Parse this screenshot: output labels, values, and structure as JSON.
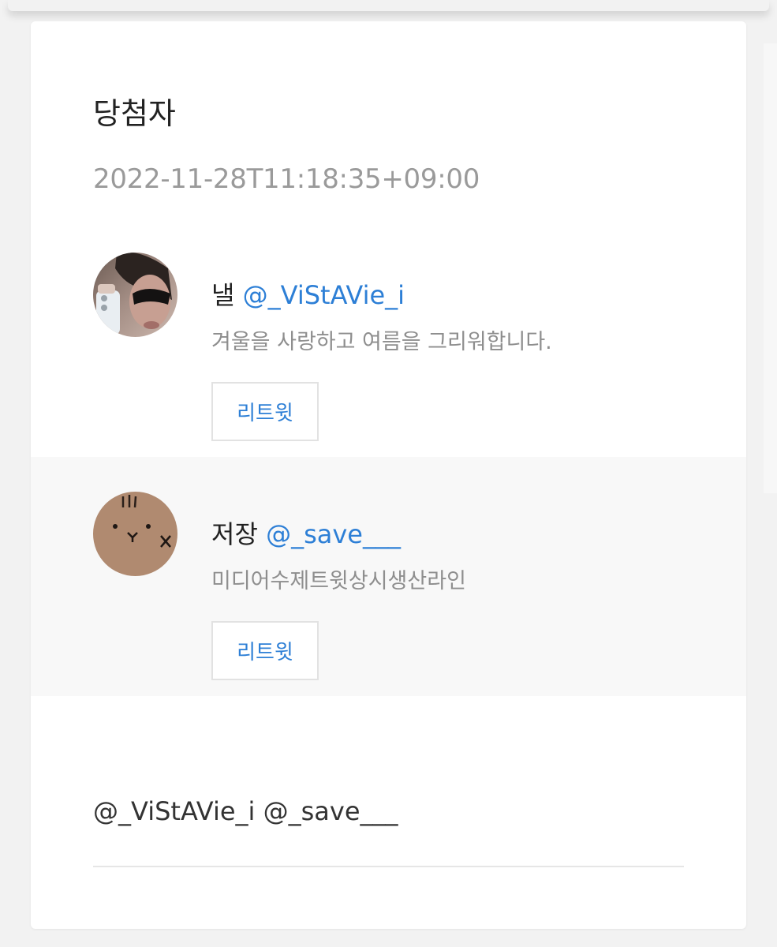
{
  "card": {
    "title": "당첨자",
    "datetime": "2022-11-28T11:18:35+09:00"
  },
  "winners": [
    {
      "name": "낼",
      "handle": "@_ViStAVie_i",
      "bio": "겨울을 사랑하고 여름을 그리워합니다.",
      "retweet_label": "리트윗"
    },
    {
      "name": "저장",
      "handle": "@_save___",
      "bio": "미디어수제트윗상시생산라인",
      "retweet_label": "리트윗"
    }
  ],
  "mentions": "@_ViStAVie_i @_save___",
  "colors": {
    "accent": "#2d7fd6",
    "background": "#f2f2f2",
    "card": "#ffffff",
    "highlight_row": "#f8f8f8"
  }
}
